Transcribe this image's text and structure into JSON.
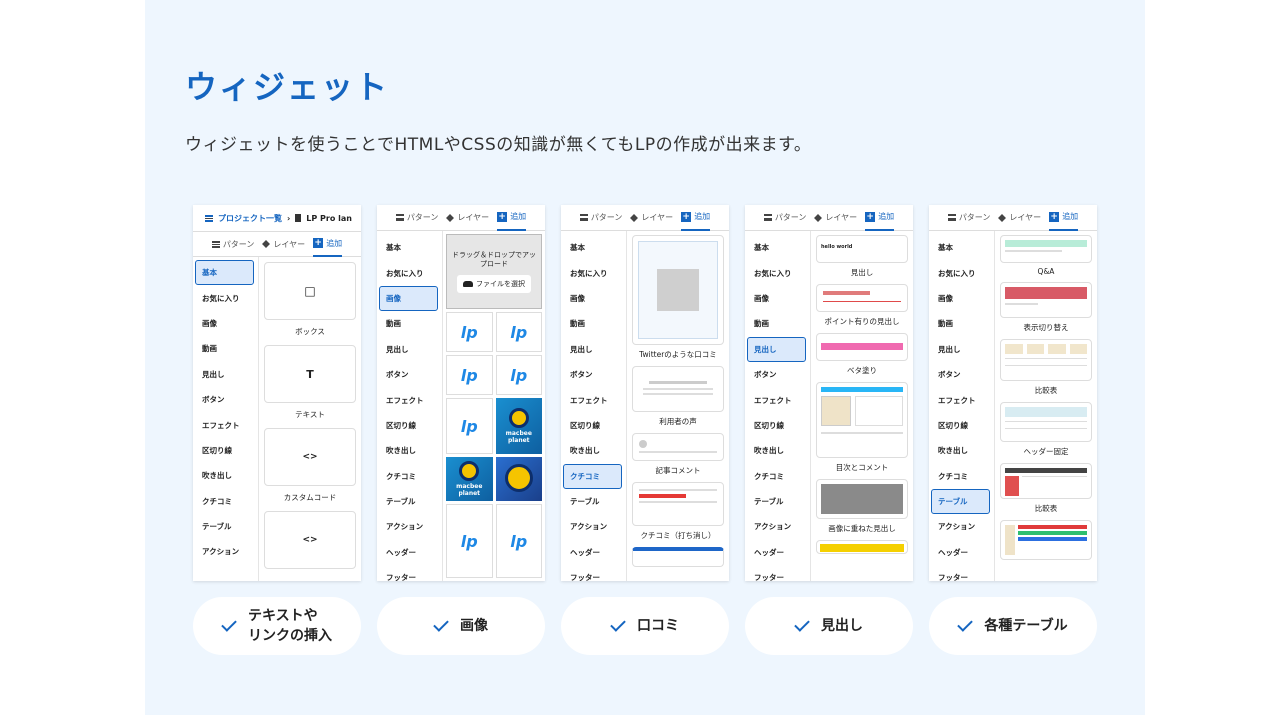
{
  "title": "ウィジェット",
  "description": "ウィジェットを使うことでHTMLやCSSの知識が無くてもLPの作成が出来ます。",
  "tabs": {
    "pattern": "パターン",
    "layer": "レイヤー",
    "add": "追加"
  },
  "sidebar": [
    "基本",
    "お気に入り",
    "画像",
    "動画",
    "見出し",
    "ボタン",
    "エフェクト",
    "区切り線",
    "吹き出し",
    "クチコミ",
    "テーブル",
    "アクション",
    "ヘッダー",
    "フッター"
  ],
  "shot1": {
    "breadcrumb_link": "プロジェクト一覧",
    "breadcrumb_sep": "›",
    "breadcrumb_current": "LP Pro lan",
    "cards": [
      {
        "glyph": "□",
        "label": "ボックス"
      },
      {
        "glyph": "T",
        "label": "テキスト"
      },
      {
        "glyph": "<>",
        "label": "カスタムコード"
      },
      {
        "glyph": "<>",
        "label": ""
      }
    ]
  },
  "shot2": {
    "upload_text": "ドラッグ＆ドロップでアップロード",
    "upload_button": "ファイルを選択",
    "logo_text": "lp",
    "macbee_text": "macbee\nplanet"
  },
  "shot3": {
    "labels": [
      "Twitterのような口コミ",
      "利用者の声",
      "記事コメント",
      "クチコミ（打ち消し）"
    ]
  },
  "shot4": {
    "labels": [
      "見出し",
      "ポイント有りの見出し",
      "ベタ塗り",
      "目次とコメント",
      "画像に重ねた見出し"
    ],
    "sample_heading": "hello world"
  },
  "shot5": {
    "labels": [
      "Q&A",
      "表示切り替え",
      "比較表",
      "ヘッダー固定",
      "比較表"
    ]
  },
  "pills": [
    {
      "line1": "テキストや",
      "line2": "リンクの挿入"
    },
    {
      "line1": "画像",
      "line2": ""
    },
    {
      "line1": "口コミ",
      "line2": ""
    },
    {
      "line1": "見出し",
      "line2": ""
    },
    {
      "line1": "各種テーブル",
      "line2": ""
    }
  ],
  "colors": {
    "accent": "#1565c0",
    "background": "#eef6fe"
  }
}
